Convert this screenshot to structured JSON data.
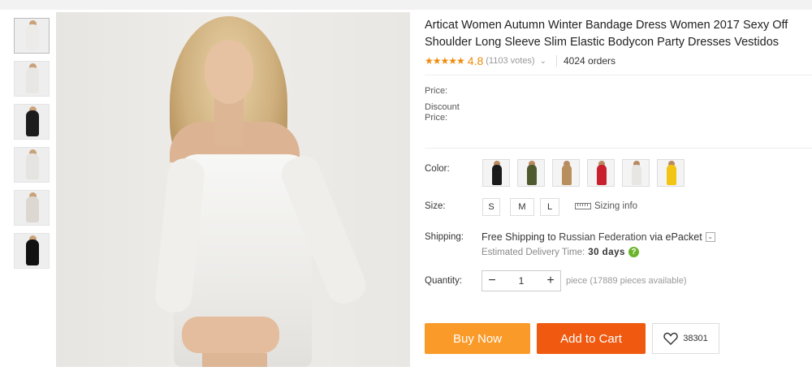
{
  "thumbnails": [
    {
      "name": "thumb-white-dress-1",
      "color": "#ecebe8"
    },
    {
      "name": "thumb-white-dress-2",
      "color": "#e9e7e4"
    },
    {
      "name": "thumb-black-dress",
      "color": "#1c1c1c"
    },
    {
      "name": "thumb-white-dress-3",
      "color": "#e6e4e0"
    },
    {
      "name": "thumb-white-dress-4",
      "color": "#dcd8d1"
    },
    {
      "name": "thumb-black-dress-2",
      "color": "#111111"
    }
  ],
  "product": {
    "title": "Articat Women Autumn Winter Bandage Dress Women 2017 Sexy Off Shoulder Long Sleeve Slim Elastic Bodycon Party Dresses Vestidos",
    "stars": "★★★★★",
    "rating": "4.8",
    "votes": "(1103 votes)",
    "votes_chevron": "⌄",
    "orders": "4024 orders"
  },
  "price": {
    "price_label": "Price:",
    "discount_label": "Discount",
    "discount_label_2": "Price:"
  },
  "color": {
    "label": "Color:",
    "swatches": [
      {
        "name": "swatch-black",
        "color": "#1a1a1a"
      },
      {
        "name": "swatch-army-green",
        "color": "#4f5a2e"
      },
      {
        "name": "swatch-khaki",
        "color": "#b8905e"
      },
      {
        "name": "swatch-red",
        "color": "#c8202e"
      },
      {
        "name": "swatch-white",
        "color": "#e8e6e2"
      },
      {
        "name": "swatch-yellow",
        "color": "#f2c413"
      }
    ]
  },
  "size": {
    "label": "Size:",
    "options": [
      "S",
      "M",
      "L"
    ],
    "sizing_info": "Sizing info"
  },
  "shipping": {
    "label": "Shipping:",
    "free": "Free Shipping to ",
    "country": "Russian Federation",
    "via": " via ePacket",
    "dropdown": "⌄",
    "eta_label": "Estimated Delivery Time:",
    "eta_value": "30 days",
    "help": "?"
  },
  "quantity": {
    "label": "Quantity:",
    "minus": "−",
    "value": "1",
    "plus": "+",
    "available": "piece (17889 pieces available)"
  },
  "actions": {
    "buy_now": "Buy Now",
    "add_to_cart": "Add to Cart",
    "wishlist_count": "38301"
  },
  "colors": {
    "accent_orange": "#f08b0b",
    "buy_now_bg": "#fa9a28",
    "add_to_cart_bg": "#f05a10",
    "help_green": "#6bb42b"
  }
}
